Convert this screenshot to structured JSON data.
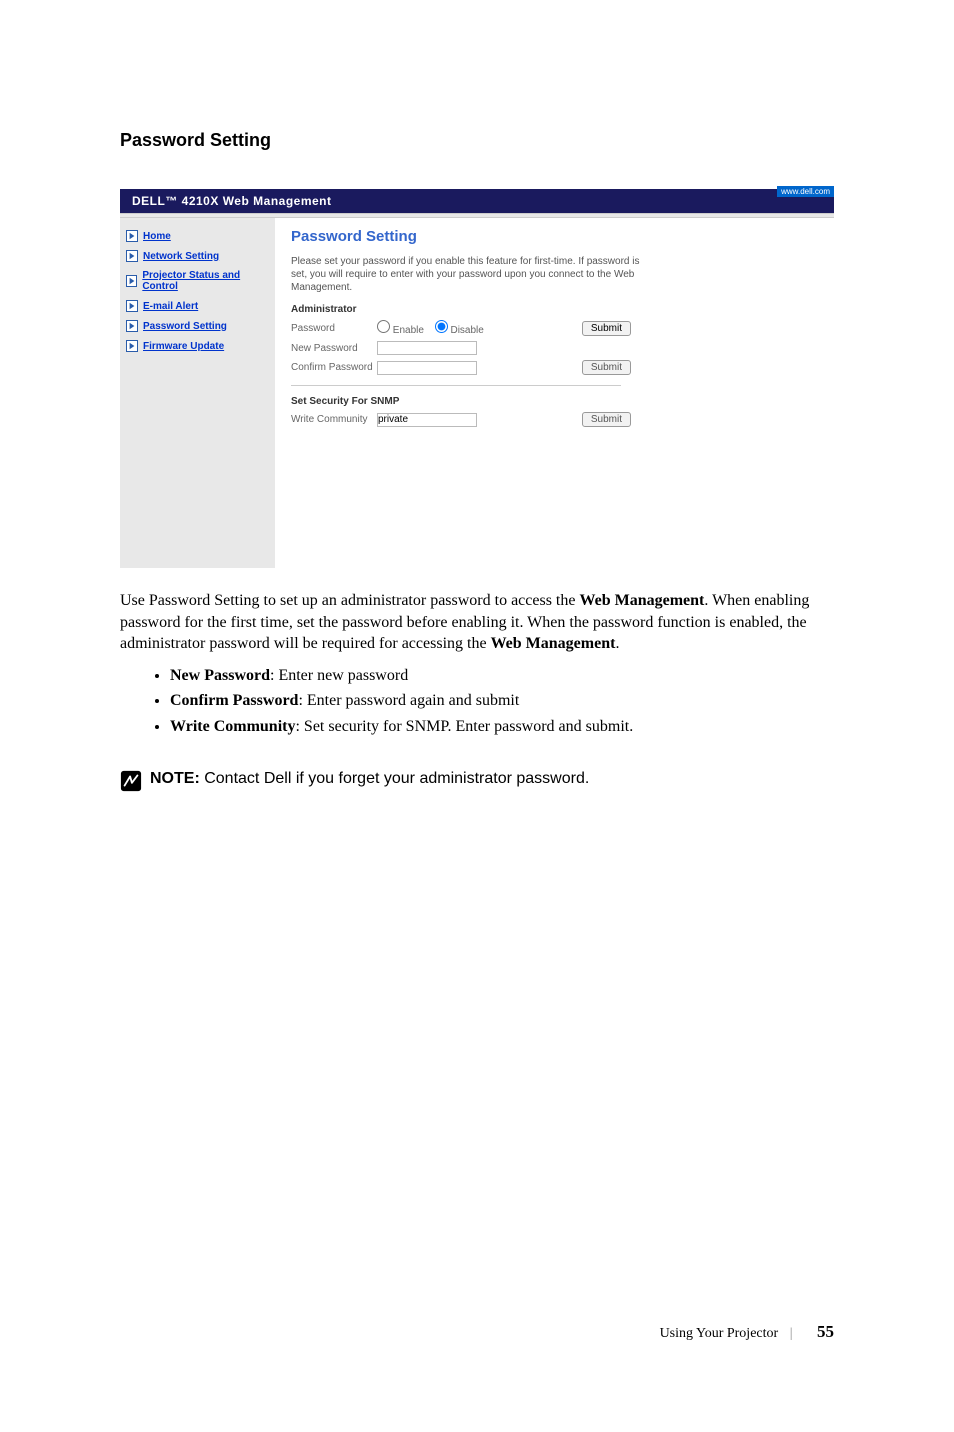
{
  "heading": "Password Setting",
  "webshot": {
    "topright": "www.dell.com",
    "logo": "DELL™  4210X Web Management",
    "nav": [
      "Home",
      "Network Setting",
      "Projector Status and Control",
      "E-mail Alert",
      "Password Setting",
      "Firmware Update"
    ],
    "content_title": "Password Setting",
    "desc": "Please set your password if you enable this feature for first-time. If password is set, you will require to enter with your password upon you connect to the Web Management.",
    "admin_section": "Administrator",
    "rows": {
      "password_label": "Password",
      "enable_label": "Enable",
      "disable_label": "Disable",
      "newpassword_label": "New Password",
      "confirmpassword_label": "Confirm Password"
    },
    "submit": "Submit",
    "snmp_section": "Set Security For SNMP",
    "snmp_row_label": "Write Community",
    "snmp_value": "private"
  },
  "paragraph_parts": {
    "p1a": "Use Password Setting to set up an administrator password to access the ",
    "p1b": "Web Management",
    "p1c": ". When enabling password for the first time, set the password before enabling it. When the password function is enabled, the administrator password will be required for accessing the ",
    "p1d": "Web Management",
    "p1e": "."
  },
  "bullets": [
    {
      "bold": "New Password",
      "rest": ": Enter new password"
    },
    {
      "bold": "Confirm Password",
      "rest": ": Enter password again and submit"
    },
    {
      "bold": "Write Community",
      "rest": ": Set security for SNMP. Enter password and submit."
    }
  ],
  "note": {
    "label": "NOTE:",
    "text": " Contact Dell if you forget your administrator password."
  },
  "footer": {
    "label": "Using Your Projector",
    "num": "55"
  }
}
